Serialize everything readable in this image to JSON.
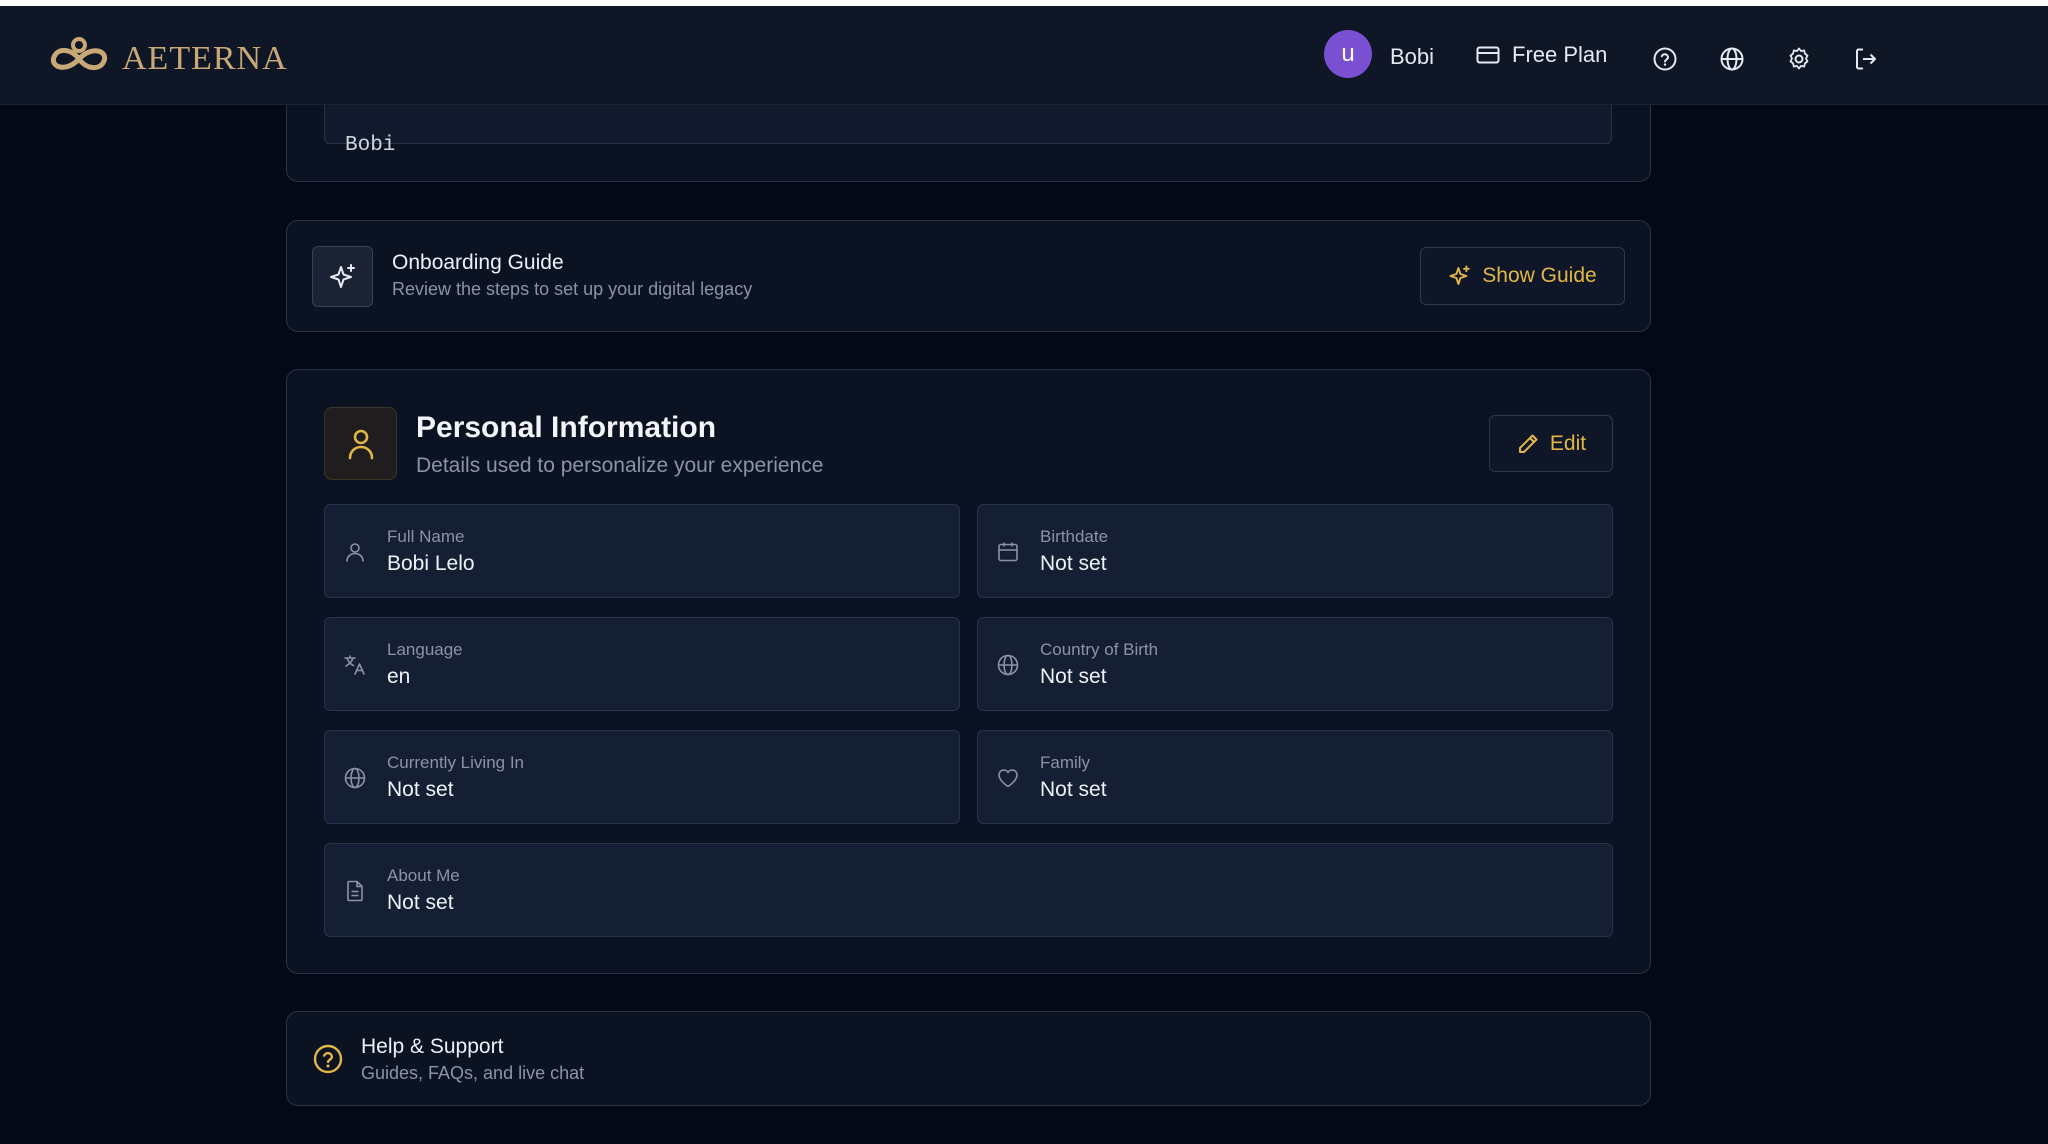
{
  "header": {
    "brand": "AETERNA",
    "avatar_initial": "u",
    "username": "Bobi",
    "plan_label": "Free Plan"
  },
  "account_card": {
    "display_name_value": "Bobi"
  },
  "onboarding": {
    "title": "Onboarding Guide",
    "subtitle": "Review the steps to set up your digital legacy",
    "button_label": "Show Guide"
  },
  "personal_info": {
    "title": "Personal Information",
    "subtitle": "Details used to personalize your experience",
    "edit_label": "Edit",
    "fields": {
      "full_name": {
        "label": "Full Name",
        "value": "Bobi Lelo",
        "icon": "user-icon"
      },
      "birthdate": {
        "label": "Birthdate",
        "value": "Not set",
        "icon": "calendar-icon"
      },
      "language": {
        "label": "Language",
        "value": "en",
        "icon": "translate-icon"
      },
      "country_of_birth": {
        "label": "Country of Birth",
        "value": "Not set",
        "icon": "globe-icon"
      },
      "currently_living_in": {
        "label": "Currently Living In",
        "value": "Not set",
        "icon": "globe-icon"
      },
      "family": {
        "label": "Family",
        "value": "Not set",
        "icon": "heart-icon"
      },
      "about_me": {
        "label": "About Me",
        "value": "Not set",
        "icon": "document-icon"
      }
    }
  },
  "help": {
    "title": "Help & Support",
    "subtitle": "Guides, FAQs, and live chat"
  },
  "colors": {
    "background": "#050816",
    "card": "#0b1222",
    "accent": "#e2b646",
    "brand": "#c8a877",
    "avatar": "#7b4fd1"
  }
}
